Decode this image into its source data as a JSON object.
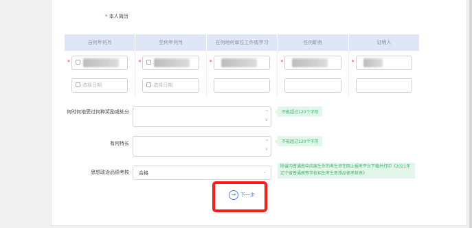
{
  "resume": {
    "required_mark": "*",
    "label": "本人简历"
  },
  "table": {
    "headers": [
      "自何年何月",
      "至何年何月",
      "在何地何单位工作或学习",
      "任何职务",
      "证明人"
    ],
    "date_placeholder": "选择日期"
  },
  "fields": {
    "awards": {
      "label": "何时何地受过何种奖励或处分",
      "hint": "不能超过120个字符"
    },
    "specialty": {
      "label": "有何特长",
      "hint": "不能超过120个字符"
    },
    "ideology": {
      "label": "思想政治品德考核",
      "value": "合格",
      "note": "除省内普通高中应届生外的考生须在网上报考平台下载并打印《2021年辽宁省普通高等学校招生考生思想品德考核表》"
    }
  },
  "next_button": {
    "label": "下一步"
  }
}
